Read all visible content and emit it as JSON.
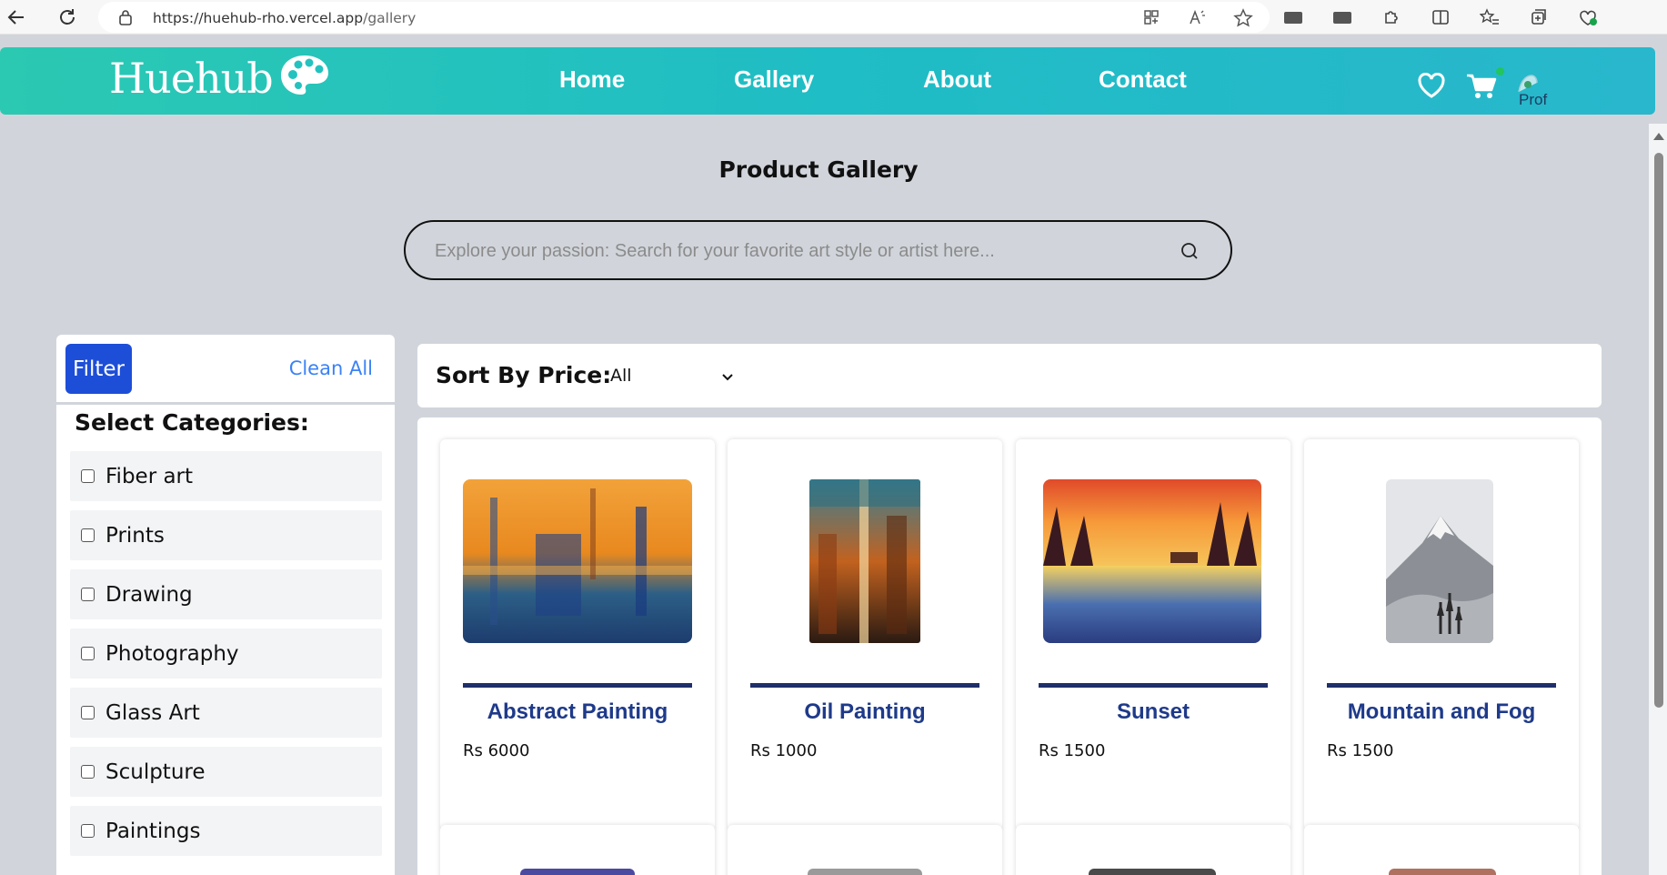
{
  "browser": {
    "url_host": "https://huehub-rho.vercel.app",
    "url_path": "/gallery"
  },
  "header": {
    "logo": "Huehub",
    "nav": [
      "Home",
      "Gallery",
      "About",
      "Contact"
    ],
    "profile_alt": "Prof"
  },
  "page": {
    "title": "Product Gallery",
    "search_placeholder": "Explore your passion: Search for your favorite art style or artist here..."
  },
  "filter": {
    "button": "Filter",
    "clean_all": "Clean All",
    "categories_title": "Select Categories:",
    "categories": [
      "Fiber art",
      "Prints",
      "Drawing",
      "Photography",
      "Glass Art",
      "Sculpture",
      "Paintings"
    ]
  },
  "sort": {
    "label": "Sort By Price:",
    "selected": "All"
  },
  "products": [
    {
      "title": "Abstract Painting",
      "price": "Rs 6000"
    },
    {
      "title": "Oil Painting",
      "price": "Rs 1000"
    },
    {
      "title": "Sunset",
      "price": "Rs 1500"
    },
    {
      "title": "Mountain and Fog",
      "price": "Rs 1500"
    }
  ],
  "colors": {
    "header_gradient_start": "#2bc9b2",
    "header_gradient_end": "#28b7cc",
    "filter_button": "#1d4ed8",
    "clean_all": "#3b82f6",
    "product_title": "#1e3a8a",
    "card_line": "#1e2f6b",
    "page_bg": "#d1d5db"
  }
}
